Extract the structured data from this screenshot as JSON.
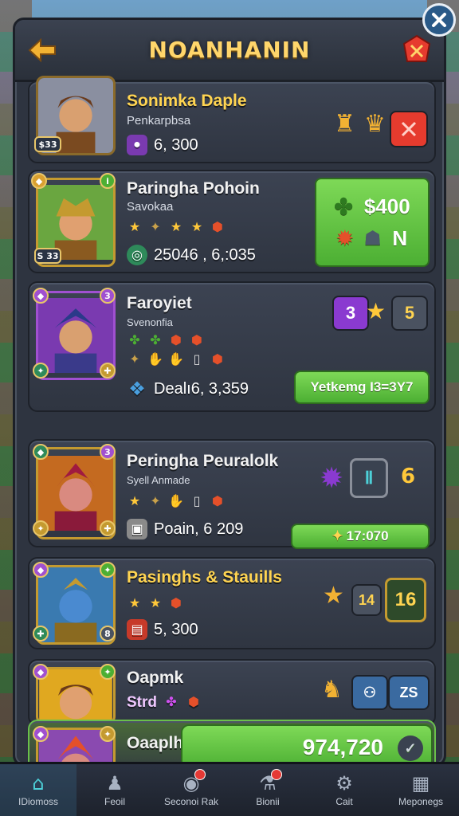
{
  "header": {
    "title": "NOANHANIN"
  },
  "heroes": [
    {
      "name": "Sonimka Daple",
      "subtitle": "Penkarpbsa",
      "stat": "6, 300",
      "name_color": "gold",
      "portrait_colors": [
        "#8a8fa0",
        "#d9a070",
        "#6b3a1a"
      ]
    },
    {
      "name": "Paringha Pohoin",
      "subtitle": "Savokaa",
      "stat": "25046 , 6,:035",
      "corner": "S 33",
      "reward_value": "$400",
      "reward_letter": "N",
      "portrait_colors": [
        "#6aa640",
        "#e0a070",
        "#8a5a20"
      ]
    },
    {
      "name": "Faroyiet",
      "subtitle": "Svenonfia",
      "stat": "Dealı6, 3,359",
      "corner_num": "3",
      "badge_num": "3",
      "level": "5",
      "action_label": "Yetkemg I3=3Y7",
      "portrait_colors": [
        "#7a3ab0",
        "#d9a070",
        "#3a3a8a"
      ]
    },
    {
      "name": "Peringha Peuralolk",
      "subtitle": "Syell Anmade",
      "stat": "Poain, 6 209",
      "corner_num": "3",
      "level": "6",
      "action_label": "17:070",
      "portrait_colors": [
        "#c46a20",
        "#d98a80",
        "#8a1a3a"
      ]
    },
    {
      "name": "Pasinghs & Stauills",
      "stat": "5, 300",
      "level_a": "14",
      "level_b": "16",
      "name_color": "gold",
      "portrait_colors": [
        "#3a7ab0",
        "#4a8ad0",
        "#c49a30"
      ]
    },
    {
      "name": "Oapmk",
      "subtitle": "Strd",
      "badge_text": "ZS",
      "portrait_colors": [
        "#e0a820",
        "#e0a070",
        "#6b3a1a"
      ]
    },
    {
      "name": "Oaaplh",
      "total": "974,720",
      "portrait_colors": [
        "#8a4ab0",
        "#d98a80",
        "#a01a20"
      ]
    }
  ],
  "nav": [
    {
      "label": "IDiomoss",
      "icon": "home-icon",
      "active": true
    },
    {
      "label": "Feoil",
      "icon": "hero-icon",
      "active": false
    },
    {
      "label": "Seconoi Rak",
      "icon": "camera-icon",
      "active": false,
      "dot": true
    },
    {
      "label": "Bionii",
      "icon": "potion-icon",
      "active": false,
      "dot": true
    },
    {
      "label": "Cait",
      "icon": "gear-icon",
      "active": false
    },
    {
      "label": "Meponegs",
      "icon": "chest-icon",
      "active": false
    }
  ],
  "colors": {
    "gold_text": "#ffd451",
    "green_button": "#5cbf3a",
    "panel": "#2e3440",
    "accent_cyan": "#4dd0d8"
  }
}
